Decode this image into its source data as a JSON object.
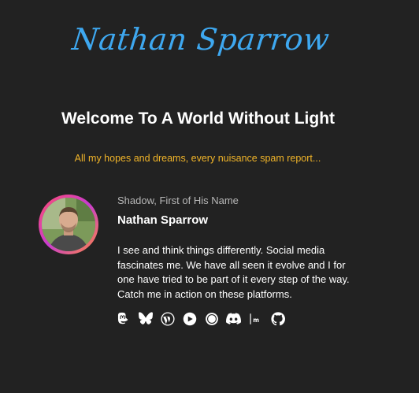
{
  "header": {
    "logo_text": "Nathan Sparrow"
  },
  "hero": {
    "headline": "Welcome To A World Without Light",
    "tagline": "All my hopes and dreams, every nuisance spam report..."
  },
  "profile": {
    "subtitle": "Shadow, First of His Name",
    "name": "Nathan Sparrow",
    "bio": "I see and think things differently. Social media fascinates me. We have all seen it evolve and I for one have tried to be part of it every step of the way. Catch me in action on these platforms.",
    "avatar_ring_colors": [
      "#ff4d6d",
      "#c83bd1",
      "#ff8a3d"
    ]
  },
  "social_links": [
    {
      "icon": "mastodon-icon"
    },
    {
      "icon": "bluesky-icon"
    },
    {
      "icon": "wordpress-icon"
    },
    {
      "icon": "micro-blog-icon"
    },
    {
      "icon": "threads-icon"
    },
    {
      "icon": "discord-icon"
    },
    {
      "icon": "medium-icon"
    },
    {
      "icon": "github-icon"
    }
  ],
  "colors": {
    "background": "#222222",
    "logo": "#3ea8f0",
    "tagline": "#f0b429",
    "subtitle": "#b7b7b7"
  }
}
